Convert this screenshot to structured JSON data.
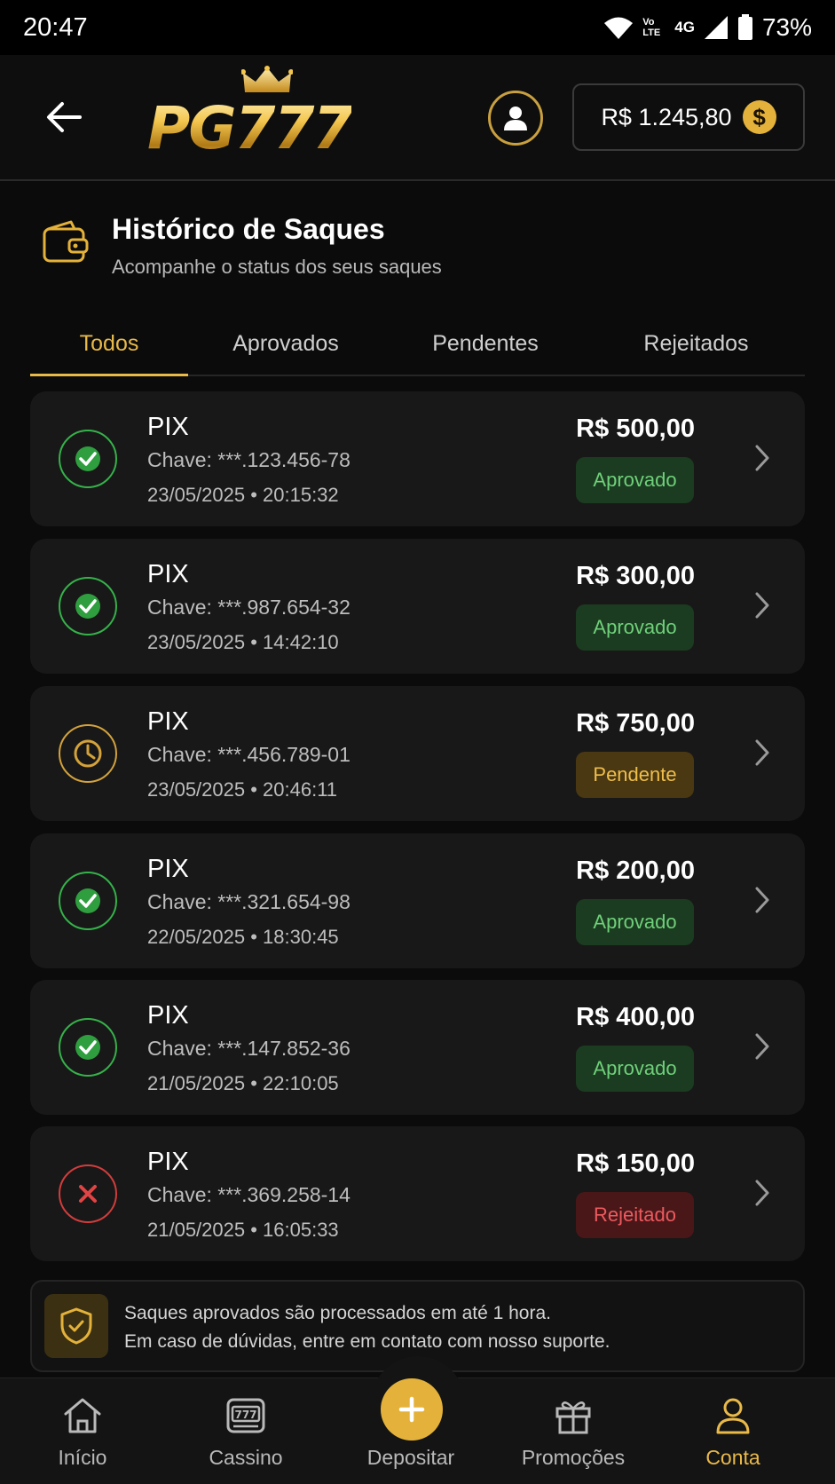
{
  "status_bar": {
    "time": "20:47",
    "network": "4G",
    "volte": "Vo LTE",
    "battery": "73%"
  },
  "header": {
    "logo_text": "PG777",
    "balance": "R$ 1.245,80",
    "coin_symbol": "$"
  },
  "page": {
    "title": "Histórico de Saques",
    "subtitle": "Acompanhe o status dos seus saques"
  },
  "tabs": [
    {
      "label": "Todos",
      "active": true
    },
    {
      "label": "Aprovados",
      "active": false
    },
    {
      "label": "Pendentes",
      "active": false
    },
    {
      "label": "Rejeitados",
      "active": false
    }
  ],
  "withdrawals": [
    {
      "method": "PIX",
      "key": "Chave: ***.123.456-78",
      "datetime": "23/05/2025 • 20:15:32",
      "amount": "R$ 500,00",
      "status": "Aprovado",
      "status_type": "approved"
    },
    {
      "method": "PIX",
      "key": "Chave: ***.987.654-32",
      "datetime": "23/05/2025 • 14:42:10",
      "amount": "R$ 300,00",
      "status": "Aprovado",
      "status_type": "approved"
    },
    {
      "method": "PIX",
      "key": "Chave: ***.456.789-01",
      "datetime": "23/05/2025 • 20:46:11",
      "amount": "R$ 750,00",
      "status": "Pendente",
      "status_type": "pending"
    },
    {
      "method": "PIX",
      "key": "Chave: ***.321.654-98",
      "datetime": "22/05/2025 • 18:30:45",
      "amount": "R$ 200,00",
      "status": "Aprovado",
      "status_type": "approved"
    },
    {
      "method": "PIX",
      "key": "Chave: ***.147.852-36",
      "datetime": "21/05/2025 • 22:10:05",
      "amount": "R$ 400,00",
      "status": "Aprovado",
      "status_type": "approved"
    },
    {
      "method": "PIX",
      "key": "Chave: ***.369.258-14",
      "datetime": "21/05/2025 • 16:05:33",
      "amount": "R$ 150,00",
      "status": "Rejeitado",
      "status_type": "rejected"
    }
  ],
  "notice": {
    "line1": "Saques aprovados são processados em até 1 hora.",
    "line2": "Em caso de dúvidas, entre em contato com nosso suporte."
  },
  "bottom_nav": [
    {
      "label": "Início",
      "icon": "home-icon",
      "active": false
    },
    {
      "label": "Cassino",
      "icon": "slot-machine-icon",
      "active": false
    },
    {
      "label": "Depositar",
      "icon": "plus-icon",
      "active": false
    },
    {
      "label": "Promoções",
      "icon": "gift-icon",
      "active": false
    },
    {
      "label": "Conta",
      "icon": "user-icon",
      "active": true
    }
  ],
  "colors": {
    "accent_gold": "#e9b949",
    "approved_green": "#35b24a",
    "pending_gold": "#d3a23b",
    "rejected_red": "#d33c3c",
    "card_bg": "#181818",
    "background": "#0b0b0b"
  }
}
